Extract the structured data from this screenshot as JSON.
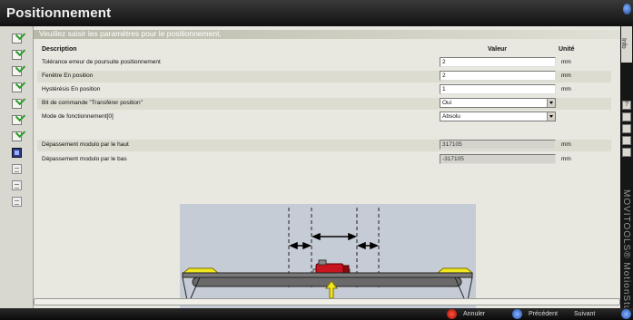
{
  "window": {
    "title": "Positionnement"
  },
  "banner": "Veuillez saisir les paramètres pour le positionnement.",
  "table": {
    "headers": {
      "description": "Description",
      "value": "Valeur",
      "unit": "Unité"
    },
    "rows": [
      {
        "label": "Tolérance erreur de poursuite positionnement",
        "value": "2",
        "unit": "mm"
      },
      {
        "label": "Fenêtre En position",
        "value": "2",
        "unit": "mm"
      },
      {
        "label": "Hystérésis En position",
        "value": "1",
        "unit": "mm"
      },
      {
        "label": "Bit de commande \"Transférer position\"",
        "value": "Oui",
        "unit": ""
      },
      {
        "label": "Mode de fonctionnement[0]",
        "value": "Absolu",
        "unit": ""
      }
    ],
    "modulo_rows": [
      {
        "label": "Dépassement modulo par le haut",
        "value": "317105",
        "unit": "mm"
      },
      {
        "label": "Dépassement modulo par le bas",
        "value": "-317105",
        "unit": "mm"
      }
    ]
  },
  "rightbar": {
    "info_label": "Info",
    "brand": "MOVITOOLS® MotionStudio"
  },
  "bottom": {
    "cancel": "Annuler",
    "previous": "Précédent",
    "next": "Suivant"
  },
  "colors": {
    "accent": "#2b3a8c",
    "motor": "#c8141e",
    "arrow": "#f0e81e"
  }
}
